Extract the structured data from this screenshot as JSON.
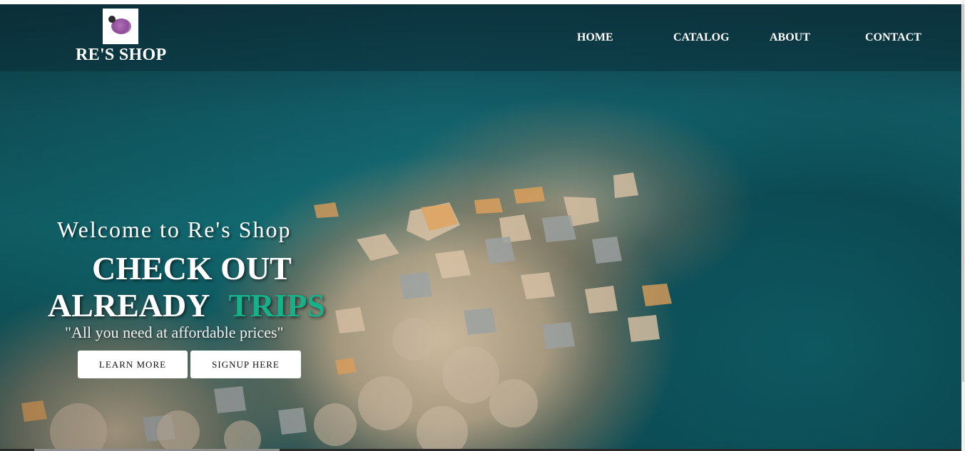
{
  "brand": {
    "name": "RE'S SHOP",
    "logo_icon": "purple-blob-logo-icon"
  },
  "nav": {
    "items": [
      {
        "label": "HOME"
      },
      {
        "label": "CATALOG"
      },
      {
        "label": "ABOUT"
      },
      {
        "label": "CONTACT"
      }
    ]
  },
  "hero": {
    "welcome": "Welcome to Re's Shop",
    "headline_line1": "CHECK OUT",
    "headline_line2_prefix": "ALREADY",
    "headline_line2_accent": "TRIPS",
    "tagline": "\"All you need at affordable prices\"",
    "buttons": {
      "learn_more": "LEARN MORE",
      "signup": "SIGNUP HERE"
    },
    "background": "aerial view of rocky shoreline and teal sea"
  },
  "colors": {
    "accent": "#16b08a",
    "nav_text": "#ffffff",
    "button_bg": "#ffffff",
    "button_text": "#111111"
  }
}
